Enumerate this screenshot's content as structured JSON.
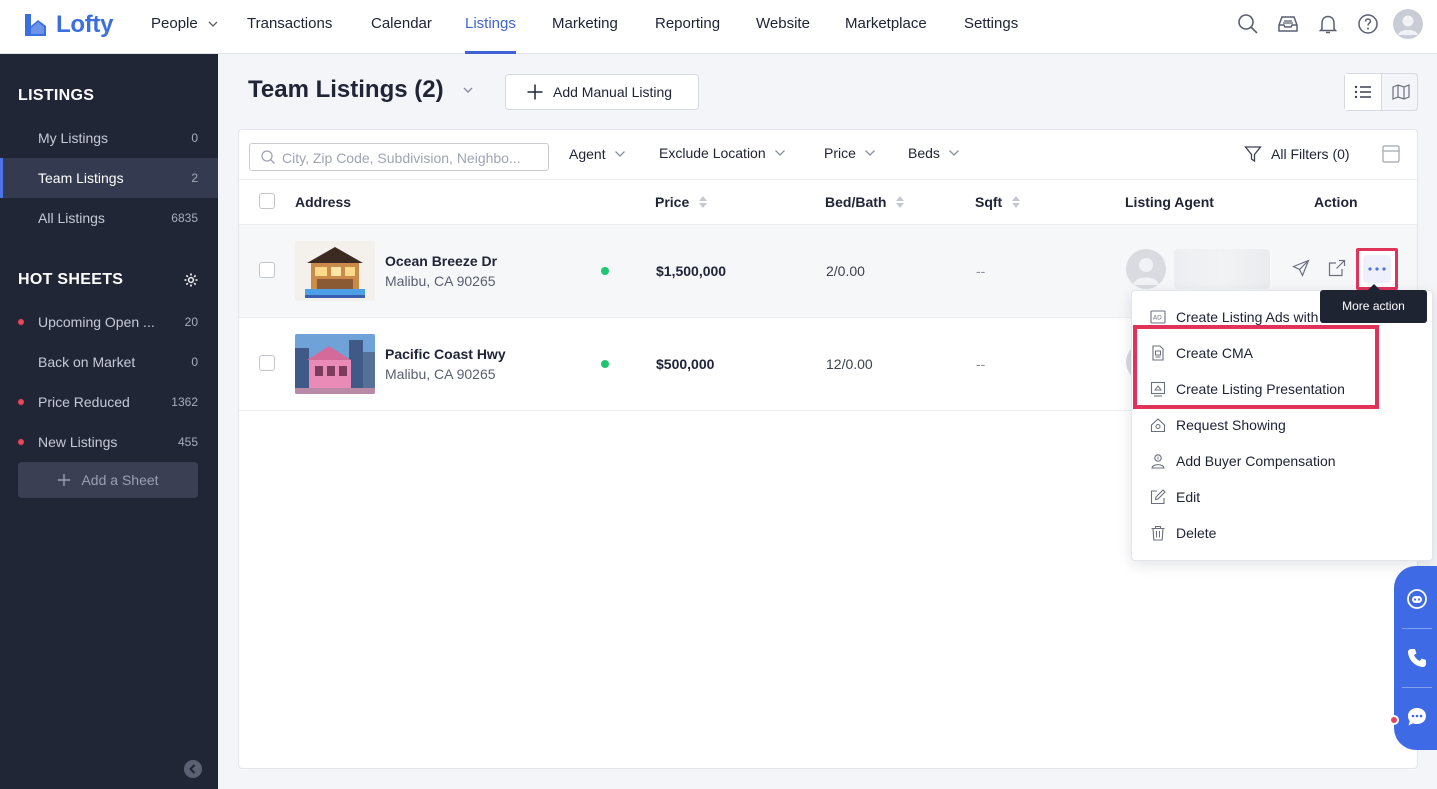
{
  "app": {
    "name": "Lofty",
    "brand_color": "#3a6fe0",
    "accent_color": "#3f63d6",
    "highlight_color": "#e0335a"
  },
  "nav": {
    "items": [
      {
        "label": "People",
        "dropdown": true
      },
      {
        "label": "Transactions"
      },
      {
        "label": "Calendar"
      },
      {
        "label": "Listings",
        "active": true
      },
      {
        "label": "Marketing"
      },
      {
        "label": "Reporting"
      },
      {
        "label": "Website"
      },
      {
        "label": "Marketplace"
      },
      {
        "label": "Settings"
      }
    ],
    "icons": [
      "search-icon",
      "inbox-icon",
      "bell-icon",
      "help-icon",
      "avatar"
    ]
  },
  "sidebar": {
    "listings_heading": "LISTINGS",
    "listings": [
      {
        "label": "My Listings",
        "count": "0"
      },
      {
        "label": "Team Listings",
        "count": "2",
        "active": true
      },
      {
        "label": "All Listings",
        "count": "6835"
      }
    ],
    "hot_sheets_heading": "HOT SHEETS",
    "hot_sheets": [
      {
        "label": "Upcoming Open ...",
        "count": "20",
        "dot": true
      },
      {
        "label": "Back on Market",
        "count": "0",
        "dot": false
      },
      {
        "label": "Price Reduced",
        "count": "1362",
        "dot": true
      },
      {
        "label": "New Listings",
        "count": "455",
        "dot": true
      }
    ],
    "add_sheet_label": "Add a Sheet"
  },
  "header": {
    "title": "Team Listings (2)",
    "add_manual_label": "Add Manual Listing"
  },
  "filters": {
    "search_placeholder": "City, Zip Code, Subdivision, Neighbo...",
    "agent": "Agent",
    "exclude_location": "Exclude Location",
    "price": "Price",
    "beds": "Beds",
    "all_filters": "All Filters (0)"
  },
  "table": {
    "columns": {
      "address": "Address",
      "price": "Price",
      "bedbath": "Bed/Bath",
      "sqft": "Sqft",
      "agent": "Listing Agent",
      "action": "Action"
    },
    "rows": [
      {
        "street": "Ocean Breeze Dr",
        "city": "Malibu, CA 90265",
        "price": "$1,500,000",
        "bedbath": "2/0.00",
        "sqft": "--"
      },
      {
        "street": "Pacific Coast Hwy",
        "city": "Malibu, CA 90265",
        "price": "$500,000",
        "bedbath": "12/0.00",
        "sqft": "--"
      }
    ]
  },
  "tooltip": {
    "text": "More action"
  },
  "action_menu": {
    "items": [
      {
        "label": "Create Listing Ads with",
        "icon": "ad-icon"
      },
      {
        "label": "Create CMA",
        "icon": "document-icon"
      },
      {
        "label": "Create Listing Presentation",
        "icon": "presentation-icon"
      },
      {
        "label": "Request Showing",
        "icon": "home-icon"
      },
      {
        "label": "Add Buyer Compensation",
        "icon": "person-money-icon"
      },
      {
        "label": "Edit",
        "icon": "edit-icon"
      },
      {
        "label": "Delete",
        "icon": "trash-icon"
      }
    ]
  }
}
